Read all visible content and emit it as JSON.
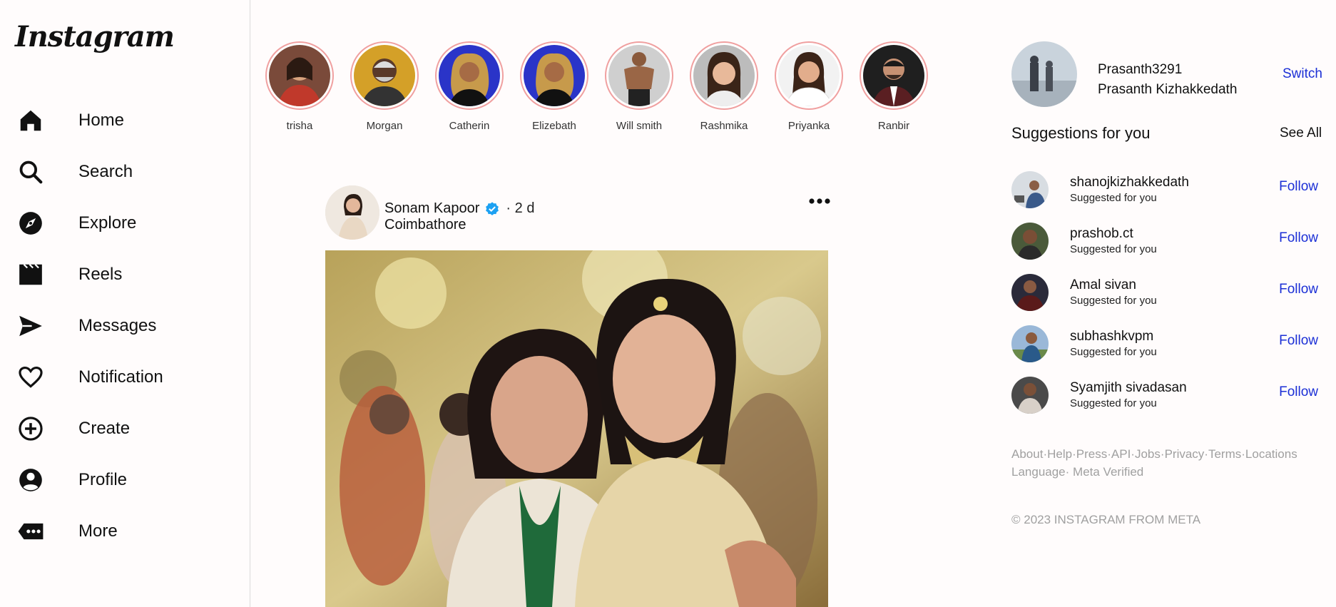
{
  "brand": {
    "logo": "Instagram"
  },
  "nav": [
    {
      "label": "Home",
      "icon": "home-icon"
    },
    {
      "label": "Search",
      "icon": "search-icon"
    },
    {
      "label": "Explore",
      "icon": "compass-icon"
    },
    {
      "label": "Reels",
      "icon": "reels-icon"
    },
    {
      "label": "Messages",
      "icon": "send-icon"
    },
    {
      "label": "Notification",
      "icon": "heart-icon"
    },
    {
      "label": "Create",
      "icon": "plus-circle-icon"
    },
    {
      "label": "Profile",
      "icon": "user-circle-icon"
    },
    {
      "label": "More",
      "icon": "more-icon"
    }
  ],
  "stories": [
    {
      "name": "trisha"
    },
    {
      "name": "Morgan"
    },
    {
      "name": "Catherin"
    },
    {
      "name": "Elizebath"
    },
    {
      "name": "Will smith"
    },
    {
      "name": "Rashmika"
    },
    {
      "name": "Priyanka"
    },
    {
      "name": "Ranbir"
    }
  ],
  "post": {
    "author": "Sonam Kapoor",
    "time": "· 2 d",
    "location": "Coimbathore"
  },
  "me": {
    "username": "Prasanth3291",
    "fullname": "Prasanth Kizhakkedath",
    "switch_label": "Switch"
  },
  "suggestions": {
    "title": "Suggestions for you",
    "see_all": "See All",
    "items": [
      {
        "name": "shanojkizhakkedath",
        "sub": "Suggested for you",
        "action": "Follow"
      },
      {
        "name": "prashob.ct",
        "sub": "Suggested for you",
        "action": "Follow"
      },
      {
        "name": "Amal sivan",
        "sub": "Suggested for you",
        "action": "Follow"
      },
      {
        "name": "subhashkvpm",
        "sub": "Suggested for you",
        "action": "Follow"
      },
      {
        "name": "Syamjith sivadasan",
        "sub": "Suggested for you",
        "action": "Follow"
      }
    ]
  },
  "footer": {
    "links": [
      "About",
      "Help",
      "Press",
      "API",
      "Jobs",
      "Privacy",
      "Terms",
      "Locations",
      "Language",
      "Meta Verified"
    ],
    "copyright": "© 2023 INSTAGRAM FROM META"
  },
  "colors": {
    "link_blue": "#1b2fd6",
    "verified_blue": "#1da1f2",
    "story_ring": "#f0a0a0",
    "muted_text": "#a0a0a0"
  }
}
